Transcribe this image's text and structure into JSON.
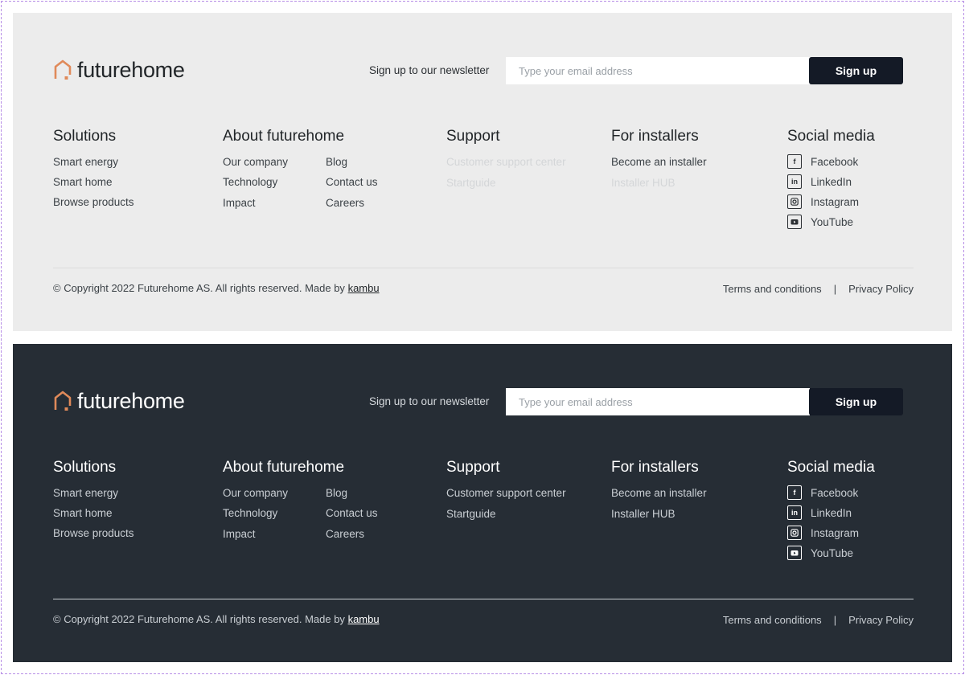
{
  "brand": {
    "name": "futurehome",
    "accent": "#e08a5a"
  },
  "newsletter": {
    "label": "Sign up to our newsletter",
    "placeholder": "Type your email address",
    "button": "Sign up"
  },
  "columns": {
    "solutions": {
      "title": "Solutions",
      "links": [
        "Smart energy",
        "Smart home",
        "Browse products"
      ]
    },
    "about": {
      "title": "About futurehome",
      "links_left": [
        "Our company",
        "Technology",
        "Impact"
      ],
      "links_right": [
        "Blog",
        "Contact us",
        "Careers"
      ]
    },
    "support": {
      "title": "Support",
      "links": [
        "Customer support center",
        "Startguide"
      ]
    },
    "installers": {
      "title": "For installers",
      "links": [
        "Become an installer",
        "Installer HUB"
      ]
    },
    "social": {
      "title": "Social media",
      "items": [
        {
          "label": "Facebook",
          "icon": "facebook-icon"
        },
        {
          "label": "LinkedIn",
          "icon": "linkedin-icon"
        },
        {
          "label": "Instagram",
          "icon": "instagram-icon"
        },
        {
          "label": "YouTube",
          "icon": "youtube-icon"
        }
      ]
    }
  },
  "bottom": {
    "copyright": "© Copyright 2022 Futurehome AS. All rights reserved. Made by",
    "made_by": "kambu",
    "terms": "Terms and conditions",
    "separator": "|",
    "privacy": "Privacy Policy"
  },
  "colors": {
    "light_bg": "#ececec",
    "dark_bg": "#262d35",
    "button_bg": "#141a26"
  }
}
